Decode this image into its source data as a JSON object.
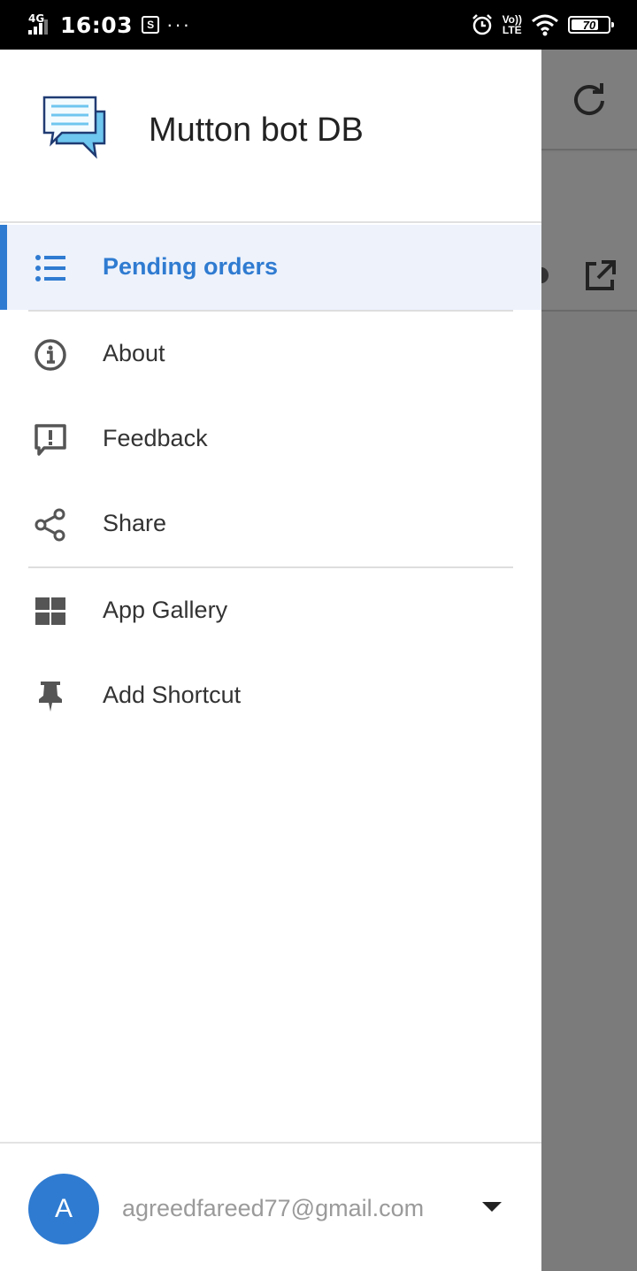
{
  "status_bar": {
    "network": "4G",
    "time": "16:03",
    "screenshot_indicator": "S",
    "overflow": "···",
    "volte_top": "Vo))",
    "volte_bottom": "LTE",
    "battery": "70"
  },
  "drawer": {
    "app_name": "Mutton bot DB",
    "items": [
      {
        "label": "Pending orders",
        "icon": "list-icon",
        "active": true
      },
      {
        "label": "About",
        "icon": "info-icon"
      },
      {
        "label": "Feedback",
        "icon": "feedback-icon"
      },
      {
        "label": "Share",
        "icon": "share-icon"
      },
      {
        "label": "App Gallery",
        "icon": "grid-icon"
      },
      {
        "label": "Add Shortcut",
        "icon": "pin-icon"
      }
    ],
    "account": {
      "initial": "A",
      "email": "agreedfareed77@gmail.com"
    }
  },
  "colors": {
    "accent": "#2f7bd1",
    "active_bg": "#edf2fb",
    "scrim": "#7b7b7b"
  }
}
